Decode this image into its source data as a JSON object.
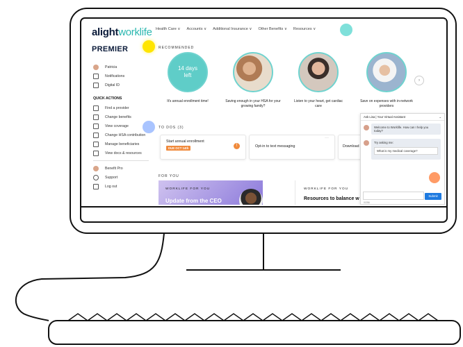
{
  "header": {
    "logo_alight": "alight",
    "logo_worklife": "worklife",
    "nav": [
      "Health Care ∨",
      "Accounts ∨",
      "Additional Insurance ∨",
      "Other Benefits ∨",
      "Resources ∨"
    ]
  },
  "sidebar": {
    "brand": "PREMIER",
    "profile": [
      {
        "label": "Patricia",
        "icon": "avatar"
      },
      {
        "label": "Notifications",
        "icon": "bell-icon"
      },
      {
        "label": "Digital ID",
        "icon": "id-card-icon"
      }
    ],
    "quick_actions_label": "QUICK ACTIONS",
    "quick_actions": [
      {
        "label": "Find a provider",
        "icon": "document-icon"
      },
      {
        "label": "Change benefits",
        "icon": "chart-icon"
      },
      {
        "label": "View coverage",
        "icon": "clipboard-icon"
      },
      {
        "label": "Change HSA contribution",
        "icon": "stack-icon"
      },
      {
        "label": "Manage beneficiaries",
        "icon": "people-icon"
      },
      {
        "label": "View docs & resources",
        "icon": "doc-icon"
      }
    ],
    "footer": [
      {
        "label": "Benefit Pro",
        "icon": "avatar"
      },
      {
        "label": "Support",
        "icon": "help-icon"
      },
      {
        "label": "Log out",
        "icon": "logout-icon"
      }
    ]
  },
  "recommended": {
    "label": "RECOMMENDED",
    "cards": [
      {
        "line1": "14 days",
        "line2": "left",
        "caption": "It's annual enrollment time!"
      },
      {
        "caption": "Saving enough in your HSA for your growing family?"
      },
      {
        "caption": "Listen to your heart, get cardiac care"
      },
      {
        "caption": "Save on expenses with in-network providers"
      }
    ]
  },
  "todos": {
    "label": "TO DOS (3)",
    "items": [
      {
        "title": "Start annual enrollment",
        "badge": "DUE OCT 14th"
      },
      {
        "title": "Opt-in to text messaging"
      },
      {
        "title": "Download"
      }
    ]
  },
  "for_you": {
    "label": "FOR YOU",
    "card1_kicker": "WORKLIFE FOR YOU",
    "card1_title": "Update from the CEO",
    "card2_kicker": "WORKLIFE FOR YOU",
    "card2_title": "Resources to balance w"
  },
  "chat": {
    "title": "Ask Lisa | Your Virtual Assistant",
    "msg1": "Welcome to Worklife. How can I help you today?",
    "msg2_name": "Try asking me:",
    "msg2": "What is my medical coverage?",
    "submit": "Submit",
    "counter": "0/256"
  },
  "colors": {
    "teal": "#2cb8b0",
    "accent_orange": "#f08a3c",
    "navy": "#0b1b3a"
  }
}
